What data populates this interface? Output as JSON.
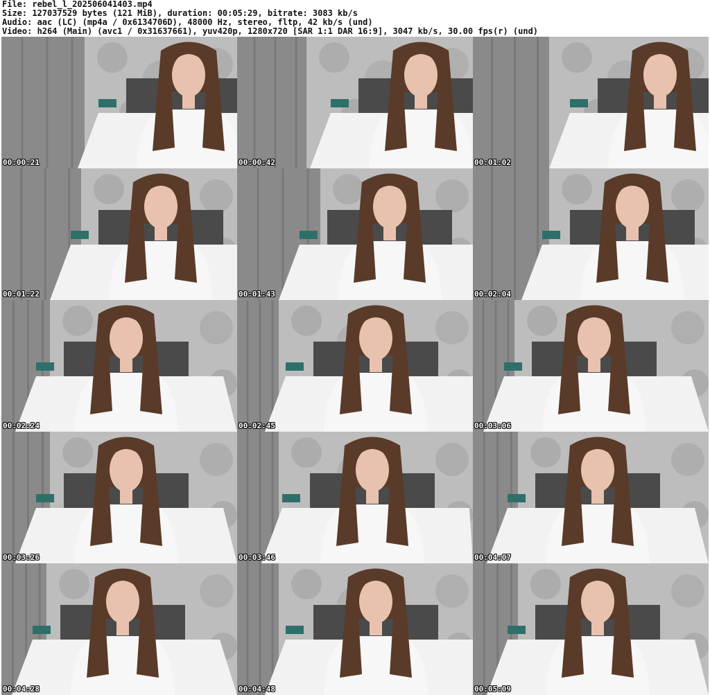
{
  "header": {
    "file_line": "File: rebel_l_202506041403.mp4",
    "size_line": "Size: 127037529 bytes (121 MiB), duration: 00:05:29, bitrate: 3083 kb/s",
    "audio_line": "Audio: aac (LC) (mp4a / 0x6134706D), 48000 Hz, stereo, fltp, 42 kb/s (und)",
    "video_line": "Video: h264 (Main) (avc1 / 0x31637661), yuv420p, 1280x720 [SAR 1:1 DAR 16:9], 3047 kb/s, 30.00 fps(r) (und)"
  },
  "thumbnails": [
    {
      "timestamp": "00:00:21"
    },
    {
      "timestamp": "00:00:42"
    },
    {
      "timestamp": "00:01:02"
    },
    {
      "timestamp": "00:01:22"
    },
    {
      "timestamp": "00:01:43"
    },
    {
      "timestamp": "00:02:04"
    },
    {
      "timestamp": "00:02:24"
    },
    {
      "timestamp": "00:02:45"
    },
    {
      "timestamp": "00:03:06"
    },
    {
      "timestamp": "00:03:26"
    },
    {
      "timestamp": "00:03:46"
    },
    {
      "timestamp": "00:04:07"
    },
    {
      "timestamp": "00:04:28"
    },
    {
      "timestamp": "00:04:48"
    },
    {
      "timestamp": "00:05:09"
    }
  ],
  "colors": {
    "curtain": "#8a8a8a",
    "wallpaper": "#bdbdbd",
    "bed": "#f2f2f2",
    "headboard": "#4a4a4a",
    "hair": "#5a3a28",
    "skin": "#e8c2ae",
    "shirt": "#f7f7f7",
    "timestamp_text": "#ffffff"
  }
}
